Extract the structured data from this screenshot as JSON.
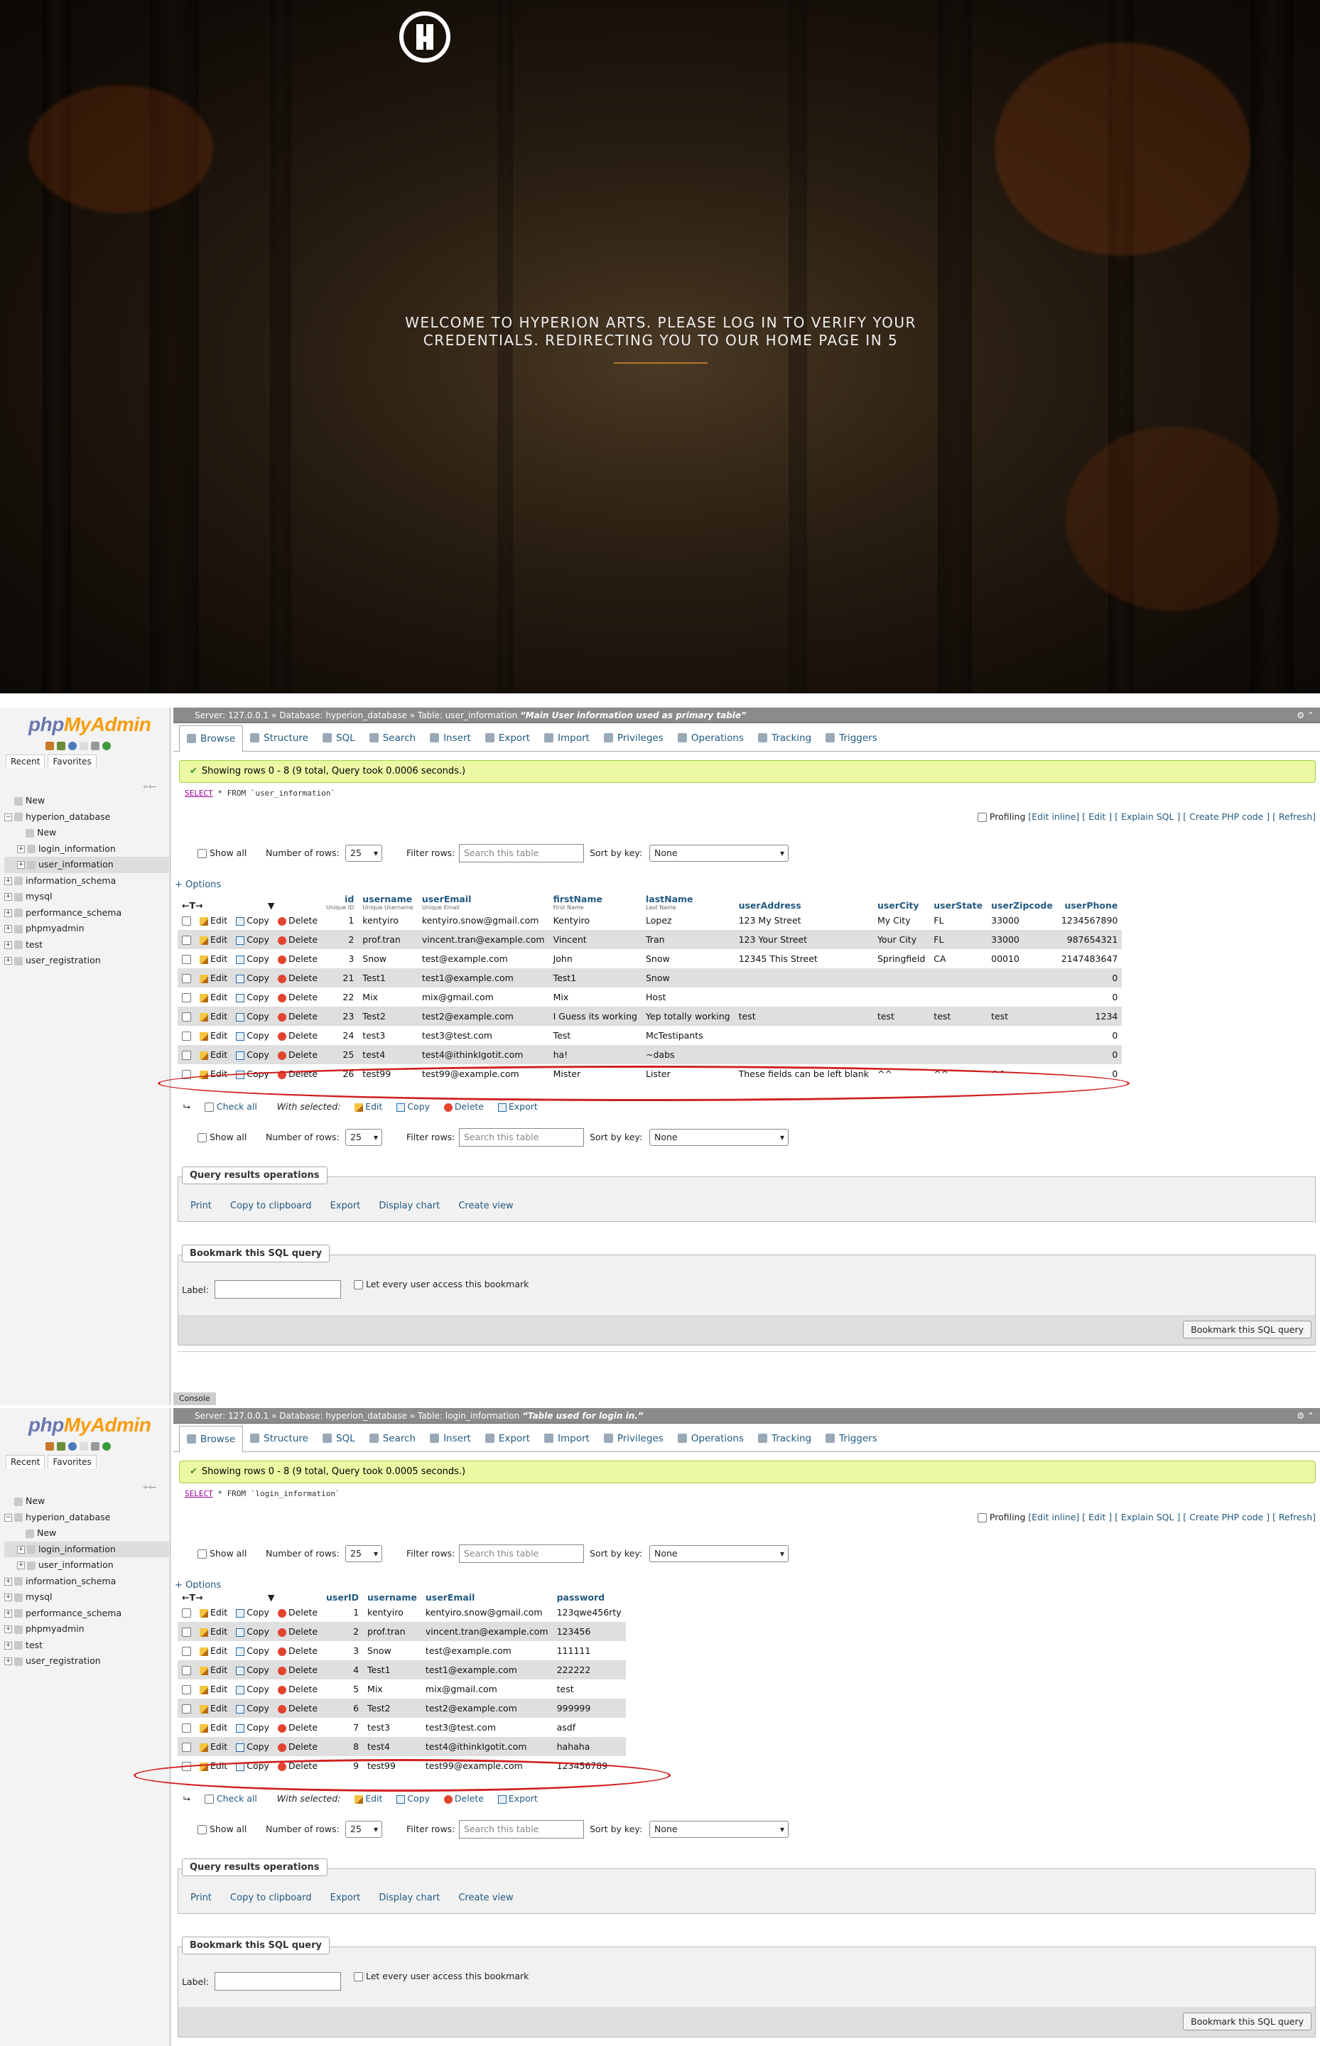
{
  "hero": {
    "welcome_text": "WELCOME TO HYPERION ARTS. PLEASE LOG IN TO VERIFY YOUR CREDENTIALS. REDIRECTING YOU TO OUR HOME PAGE IN 5",
    "logo_icon": "hyperion-h-logo"
  },
  "pma1": {
    "brand_php": "php",
    "brand_my": "MyAdmin",
    "nav_tabs": [
      "Recent",
      "Favorites"
    ],
    "tree": [
      "New",
      "hyperion_database",
      "New",
      "login_information",
      "user_information",
      "information_schema",
      "mysql",
      "performance_schema",
      "phpmyadmin",
      "test",
      "user_registration"
    ],
    "topbar": "Server: 127.0.0.1 » Database: hyperion_database » Table: user_information",
    "topbar_comment": "“Main User information used as primary table”",
    "tabs": [
      "Browse",
      "Structure",
      "SQL",
      "Search",
      "Insert",
      "Export",
      "Import",
      "Privileges",
      "Operations",
      "Tracking",
      "Triggers"
    ],
    "success": "Showing rows 0 - 8 (9 total, Query took 0.0006 seconds.)",
    "sql_kw": "SELECT",
    "sql_rest": " * FROM `user_information`",
    "profiling": "Profiling",
    "profiling_links": "[Edit inline] [ Edit ] [ Explain SQL ] [ Create PHP code ] [ Refresh]",
    "show_all": "Show all",
    "num_rows_label": "Number of rows:",
    "num_rows_value": "25",
    "filter_label": "Filter rows:",
    "filter_placeholder": "Search this table",
    "sort_label": "Sort by key:",
    "sort_value": "None",
    "options": "+ Options",
    "columns": [
      {
        "name": "id",
        "sub": "Unique ID"
      },
      {
        "name": "username",
        "sub": "Unique Username"
      },
      {
        "name": "userEmail",
        "sub": "Unique Email"
      },
      {
        "name": "firstName",
        "sub": "First Name"
      },
      {
        "name": "lastName",
        "sub": "Last Name"
      },
      {
        "name": "userAddress",
        "sub": ""
      },
      {
        "name": "userCity",
        "sub": ""
      },
      {
        "name": "userState",
        "sub": ""
      },
      {
        "name": "userZipcode",
        "sub": ""
      },
      {
        "name": "userPhone",
        "sub": ""
      }
    ],
    "rows": [
      [
        "1",
        "kentyiro",
        "kentyiro.snow@gmail.com",
        "Kentyiro",
        "Lopez",
        "123 My Street",
        "My City",
        "FL",
        "33000",
        "1234567890"
      ],
      [
        "2",
        "prof.tran",
        "vincent.tran@example.com",
        "Vincent",
        "Tran",
        "123 Your Street",
        "Your City",
        "FL",
        "33000",
        "987654321"
      ],
      [
        "3",
        "Snow",
        "test@example.com",
        "John",
        "Snow",
        "12345 This Street",
        "Springfield",
        "CA",
        "00010",
        "2147483647"
      ],
      [
        "21",
        "Test1",
        "test1@example.com",
        "Test1",
        "Snow",
        "",
        "",
        "",
        "",
        "0"
      ],
      [
        "22",
        "Mix",
        "mix@gmail.com",
        "Mix",
        "Host",
        "",
        "",
        "",
        "",
        "0"
      ],
      [
        "23",
        "Test2",
        "test2@example.com",
        "I Guess its working",
        "Yep totally working",
        "test",
        "test",
        "test",
        "test",
        "1234"
      ],
      [
        "24",
        "test3",
        "test3@test.com",
        "Test",
        "McTestipants",
        "",
        "",
        "",
        "",
        "0"
      ],
      [
        "25",
        "test4",
        "test4@ithinkIgotit.com",
        "ha!",
        "~dabs",
        "",
        "",
        "",
        "",
        "0"
      ],
      [
        "26",
        "test99",
        "test99@example.com",
        "Mister",
        "Lister",
        "These fields can be left blank",
        "^^",
        "^^",
        "^^",
        "0"
      ]
    ],
    "edit": "Edit",
    "copy": "Copy",
    "delete": "Delete",
    "export": "Export",
    "check_all": "Check all",
    "with_selected": "With selected:",
    "qro_legend": "Query results operations",
    "qro_items": [
      "Print",
      "Copy to clipboard",
      "Export",
      "Display chart",
      "Create view"
    ],
    "bookmark_legend": "Bookmark this SQL query",
    "bookmark_label": "Label:",
    "bookmark_every": "Let every user access this bookmark",
    "bookmark_button": "Bookmark this SQL query",
    "console": "Console"
  },
  "pma2": {
    "topbar": "Server: 127.0.0.1 » Database: hyperion_database » Table: login_information",
    "topbar_comment": "“Table used for login in.”",
    "success": "Showing rows 0 - 8 (9 total, Query took 0.0005 seconds.)",
    "sql_rest": " * FROM `login_information`",
    "columns": [
      "userID",
      "username",
      "userEmail",
      "password"
    ],
    "rows": [
      [
        "1",
        "kentyiro",
        "kentyiro.snow@gmail.com",
        "123qwe456rty"
      ],
      [
        "2",
        "prof.tran",
        "vincent.tran@example.com",
        "123456"
      ],
      [
        "3",
        "Snow",
        "test@example.com",
        "111111"
      ],
      [
        "4",
        "Test1",
        "test1@example.com",
        "222222"
      ],
      [
        "5",
        "Mix",
        "mix@gmail.com",
        "test"
      ],
      [
        "6",
        "Test2",
        "test2@example.com",
        "999999"
      ],
      [
        "7",
        "test3",
        "test3@test.com",
        "asdf"
      ],
      [
        "8",
        "test4",
        "test4@ithinkIgotit.com",
        "hahaha"
      ],
      [
        "9",
        "test99",
        "test99@example.com",
        "123456789"
      ]
    ]
  },
  "colors": {
    "link": "#235a81",
    "success_bg": "#ebf8a4",
    "highlight_ring": "#d02020",
    "accent_line": "#b9762c"
  }
}
